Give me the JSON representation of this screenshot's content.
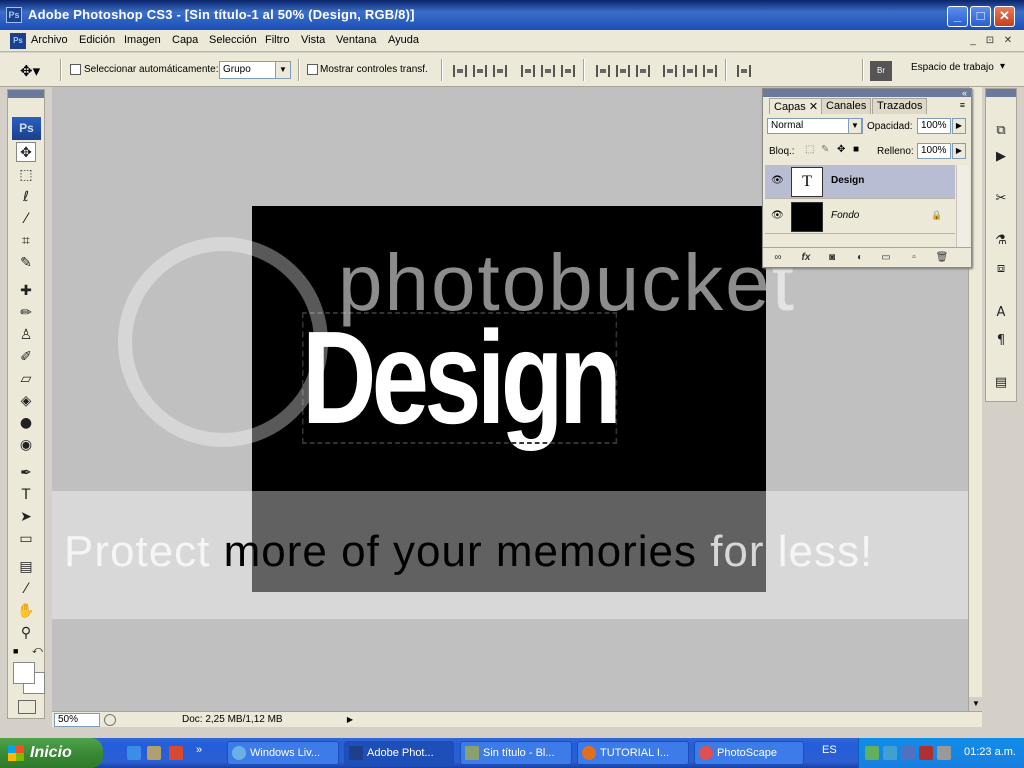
{
  "window": {
    "title": "Adobe Photoshop CS3 - [Sin título-1 al 50% (Design, RGB/8)]",
    "app_icon_text": "Ps",
    "controls": [
      "_",
      "□",
      "✕"
    ]
  },
  "menu": {
    "items": [
      "Archivo",
      "Edición",
      "Imagen",
      "Capa",
      "Selección",
      "Filtro",
      "Vista",
      "Ventana",
      "Ayuda"
    ],
    "doc_controls": [
      "_",
      "⊡",
      "✕"
    ]
  },
  "options": {
    "auto_select_label": "Seleccionar automáticamente:",
    "auto_select_value": "Grupo",
    "show_transform_label": "Mostrar controles transf.",
    "workspace_label": "Espacio de trabajo",
    "workspace_arrow": "▾"
  },
  "tools": {
    "logo": "Ps"
  },
  "canvas": {
    "text": "Design",
    "watermark_top": "photobucket",
    "watermark_bottom_light1": "Protect ",
    "watermark_bottom_dark": "more of your memories",
    "watermark_bottom_light2": " for less!"
  },
  "status": {
    "zoom": "50%",
    "doc": "Doc: 2,25 MB/1,12 MB",
    "arrow": "▶"
  },
  "layers_panel": {
    "tabs": [
      "Capas",
      "Canales",
      "Trazados"
    ],
    "tab_close": "✕",
    "blend_mode": "Normal",
    "opacity_label": "Opacidad:",
    "opacity_value": "100%",
    "lock_label": "Bloq.:",
    "fill_label": "Relleno:",
    "fill_value": "100%",
    "layers": [
      {
        "name": "Design",
        "thumb": "T"
      },
      {
        "name": "Fondo",
        "thumb": ""
      }
    ],
    "fx": "fx"
  },
  "taskbar": {
    "start_label": "Inicio",
    "buttons": [
      "Windows Liv...",
      "Adobe Phot...",
      "Sin título - Bl...",
      "TUTORIAL I...",
      "PhotoScape"
    ],
    "lang": "ES",
    "clock": "01:23 a.m."
  }
}
